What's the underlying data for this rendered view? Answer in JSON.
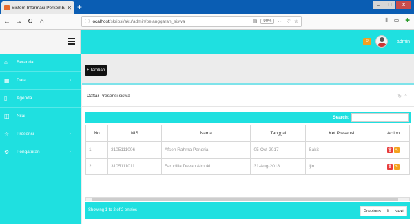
{
  "browser": {
    "tab_title": "Sistem Informasi Perkembangan",
    "new_tab": "+",
    "url_host": "localhost",
    "url_path": "/skripsi/aku/admin/pelanggaran_siswa",
    "zoom": "90%"
  },
  "header": {
    "notif_count": "0",
    "user_name": "admin"
  },
  "sidebar": {
    "items": [
      {
        "label": "Beranda",
        "icon": "home-icon",
        "chev": ""
      },
      {
        "label": "Data",
        "icon": "table-icon",
        "chev": "›"
      },
      {
        "label": "Agenda",
        "icon": "agenda-icon",
        "chev": ""
      },
      {
        "label": "Nilai",
        "icon": "chart-icon",
        "chev": ""
      },
      {
        "label": "Presensi",
        "icon": "star-icon",
        "chev": "›"
      },
      {
        "label": "Pengaturan",
        "icon": "gear-icon",
        "chev": "›"
      }
    ]
  },
  "main": {
    "add_button": "+ Tambah",
    "panel_title": "Daftar Presensi siswa",
    "search_label": "Search:",
    "search_value": "",
    "columns": [
      "No",
      "NIS",
      "Nama",
      "Tanggal",
      "Ket Presensi",
      "Action"
    ],
    "rows": [
      [
        "1",
        "3105111006",
        "Afsen Rahma Pandria",
        "05-Oct-2017",
        "Sakit"
      ],
      [
        "2",
        "3105111011",
        "Farudilla Devan Almuki",
        "31-Aug-2018",
        "ijin"
      ]
    ],
    "info": "Showing 1 to 2 of 2 entries",
    "pager": {
      "previous": "Previous",
      "current": "1",
      "next": "Next"
    }
  }
}
